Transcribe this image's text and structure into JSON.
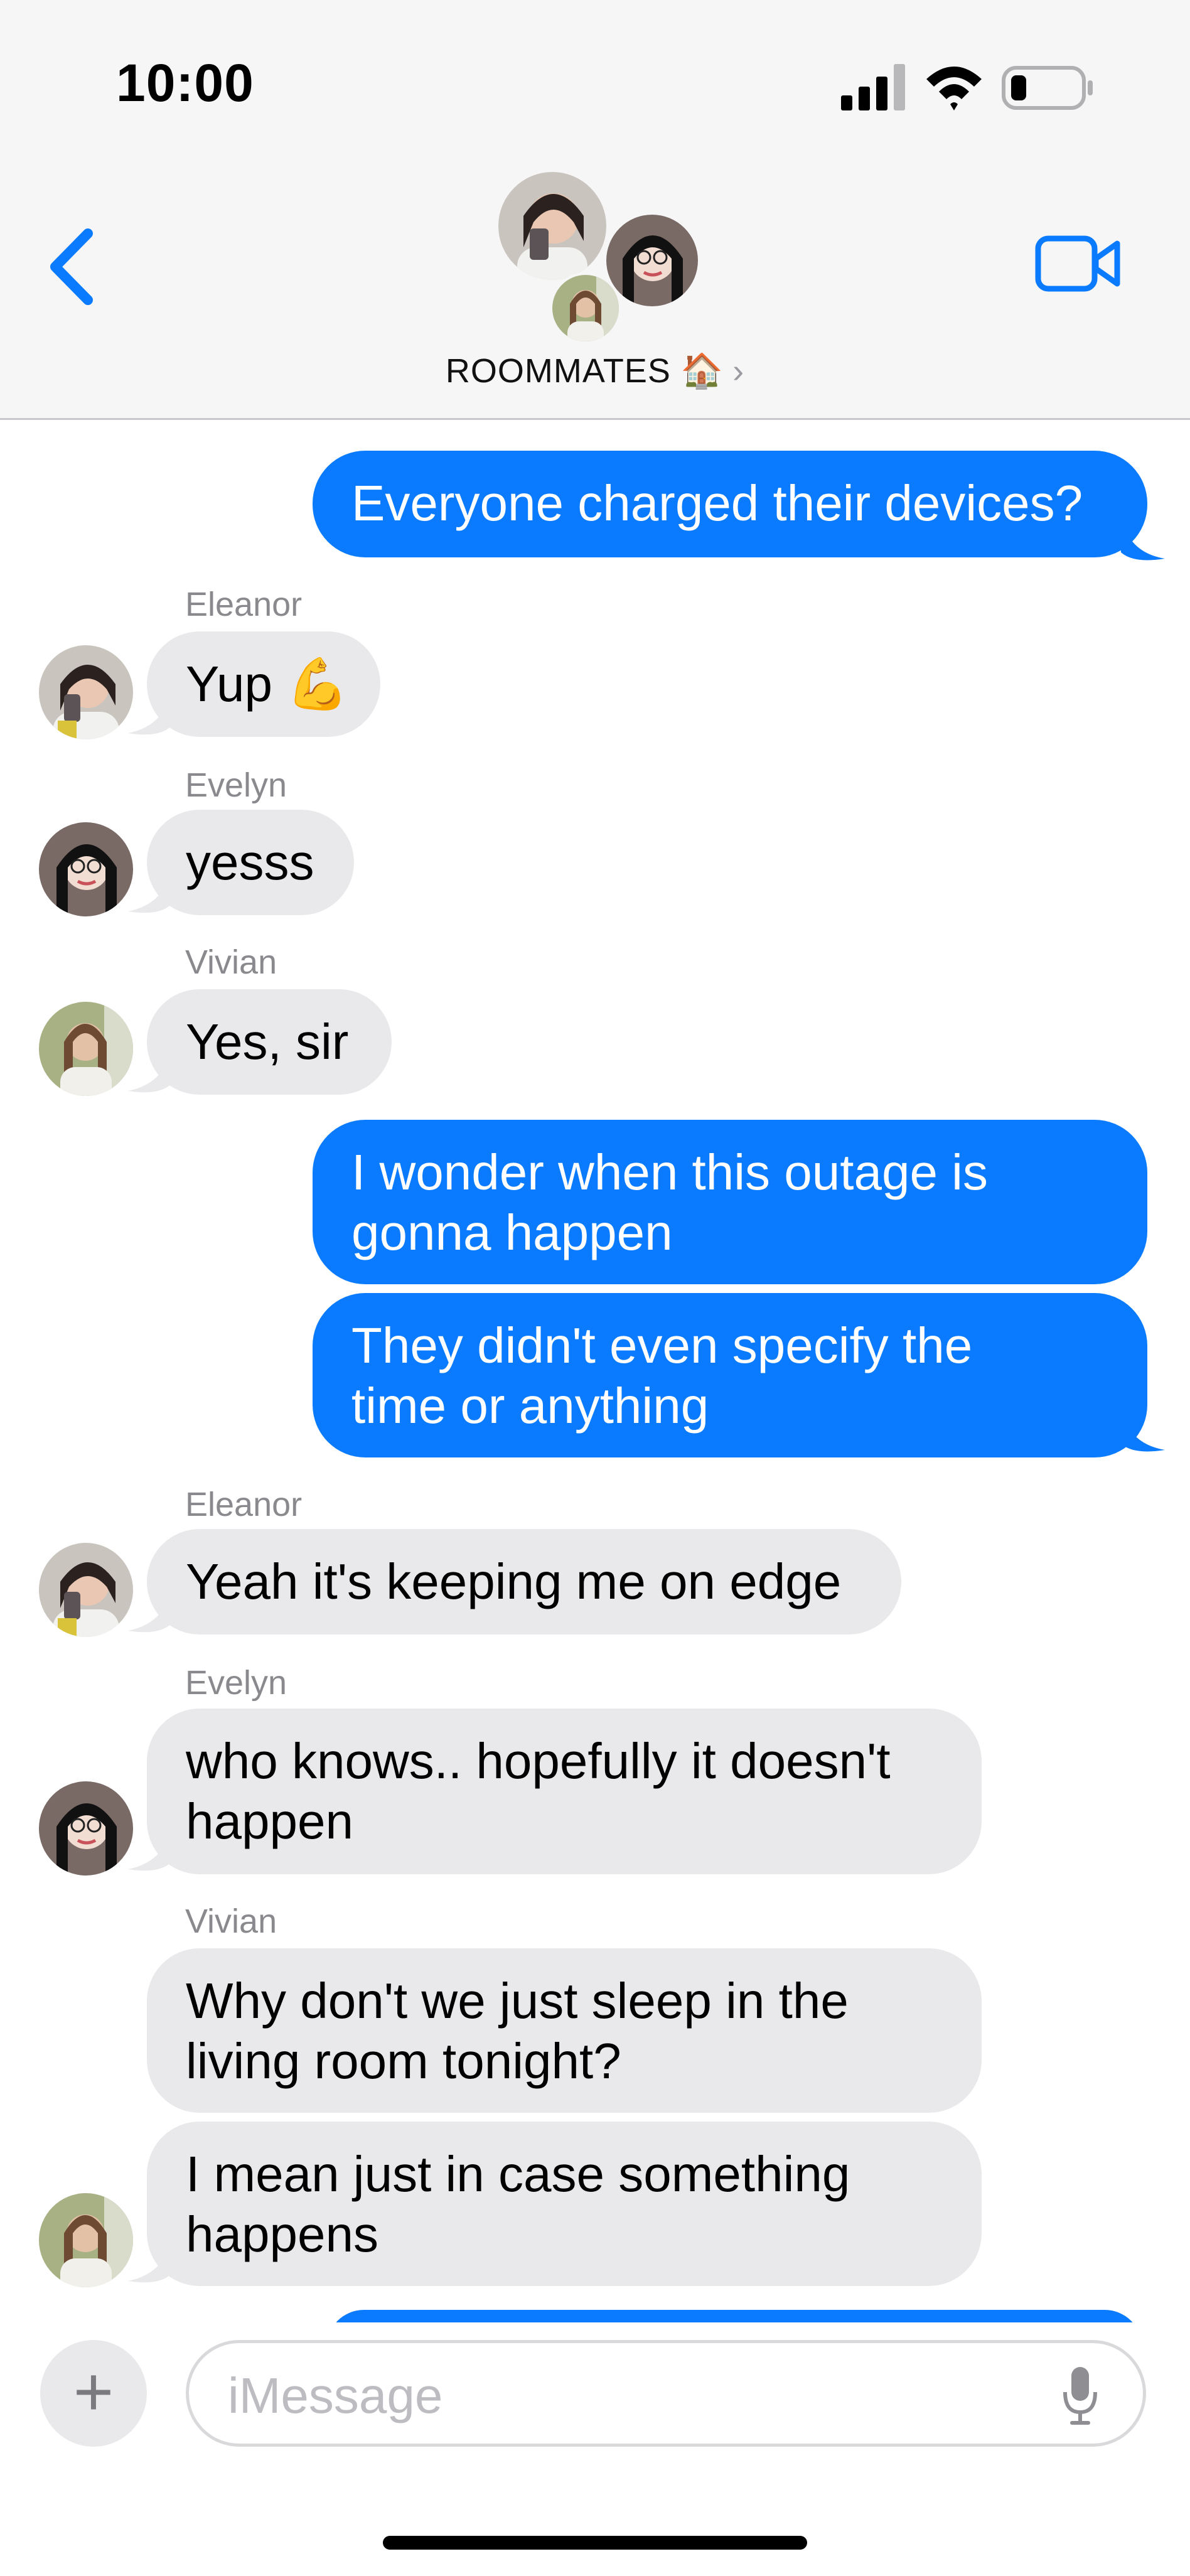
{
  "status_bar": {
    "time": "10:00"
  },
  "header": {
    "group_name": "ROOMMATES 🏠",
    "chevron": "›"
  },
  "messages": [
    {
      "from": "me",
      "text_lines": [
        "Everyone charged their devices?"
      ]
    },
    {
      "from": "Eleanor",
      "text_lines": [
        "Yup 💪"
      ]
    },
    {
      "from": "Evelyn",
      "text_lines": [
        "yesss"
      ]
    },
    {
      "from": "Vivian",
      "text_lines": [
        "Yes, sir"
      ]
    },
    {
      "from": "me",
      "text_lines": [
        "I wonder when this outage is",
        "gonna happen"
      ]
    },
    {
      "from": "me",
      "text_lines": [
        "They didn't even specify the",
        "time or anything"
      ]
    },
    {
      "from": "Eleanor",
      "text_lines": [
        "Yeah it's keeping me on edge"
      ]
    },
    {
      "from": "Evelyn",
      "text_lines": [
        "who knows.. hopefully it doesn't",
        "happen"
      ]
    },
    {
      "from": "Vivian",
      "text_lines": [
        "Why don't we just sleep in the",
        "living room tonight?"
      ]
    },
    {
      "from": "Vivian",
      "text_lines": [
        "I mean just in case something",
        "happens"
      ]
    }
  ],
  "composer": {
    "placeholder": "iMessage",
    "plus": "+"
  },
  "colors": {
    "outgoing": "#0a7bfe",
    "incoming": "#e9e9eb",
    "accent": "#0a7bfe"
  },
  "icons": [
    "signal-icon",
    "wifi-icon",
    "battery-icon",
    "back-chevron-icon",
    "video-call-icon",
    "plus-icon",
    "microphone-icon"
  ]
}
